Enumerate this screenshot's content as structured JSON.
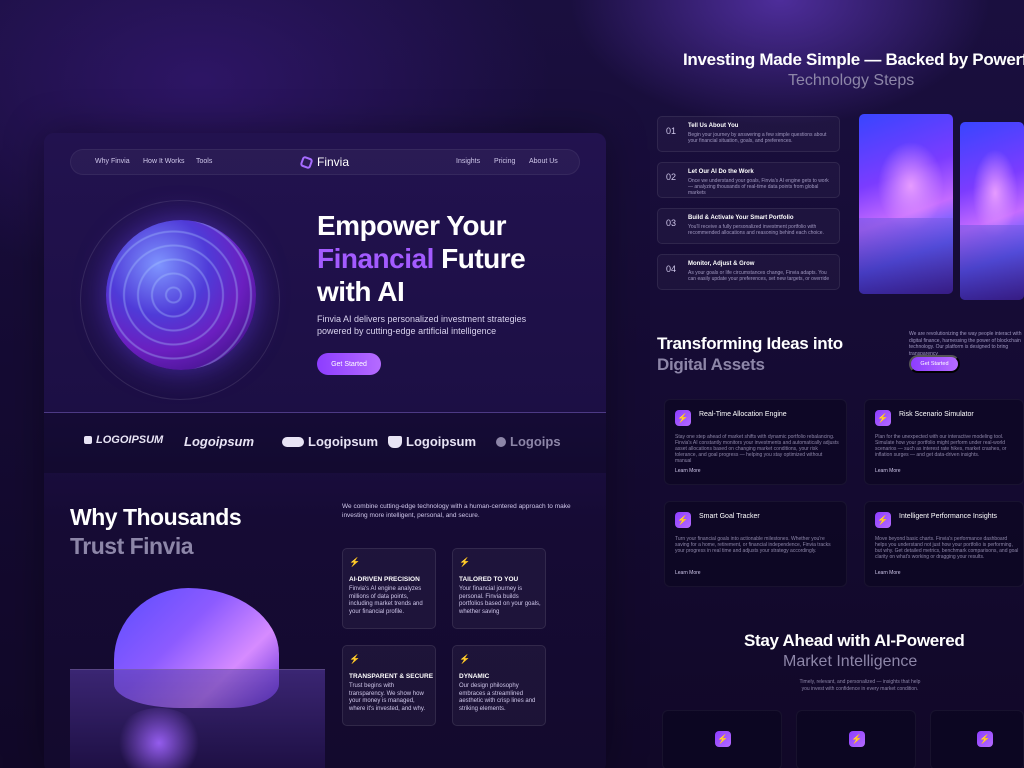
{
  "nav": {
    "left_links": [
      "Why Finvia",
      "How It Works",
      "Tools"
    ],
    "brand": "Finvia",
    "right_links": [
      "Insights",
      "Pricing",
      "About Us"
    ]
  },
  "hero": {
    "title_line1": "Empower Your",
    "title_accent": "Financial",
    "title_line2_rest": " Future",
    "title_line3": "with AI",
    "subtitle": "Finvia AI delivers personalized investment strategies powered by cutting-edge artificial intelligence",
    "cta": "Get Started"
  },
  "logos": [
    "LOGOIPSUM",
    "Logoipsum",
    "Logoipsum",
    "Logoipsum",
    "Logoips"
  ],
  "why": {
    "title_line1": "Why Thousands",
    "title_line2": "Trust Finvia",
    "description": "We combine cutting-edge technology with a human-centered approach to make investing more intelligent, personal, and secure.",
    "features": [
      {
        "title": "AI-DRIVEN PRECISION",
        "text": "Finvia's AI engine analyzes millions of data points, including market trends and your financial profile."
      },
      {
        "title": "TAILORED TO YOU",
        "text": "Your financial journey is personal. Finvia builds portfolios based on your goals, whether saving"
      },
      {
        "title": "TRANSPARENT & SECURE",
        "text": "Trust begins with transparency. We show how your money is managed, where it's invested, and why."
      },
      {
        "title": "DYNAMIC",
        "text": "Our design philosophy embraces a streamlined aesthetic with crisp lines and striking elements."
      }
    ]
  },
  "steps": {
    "title_line1": "Investing Made Simple — Backed by Powerful",
    "title_line2": "Technology Steps",
    "items": [
      {
        "num": "01",
        "title": "Tell Us About You",
        "text": "Begin your journey by answering a few simple questions about your financial situation, goals, and preferences."
      },
      {
        "num": "02",
        "title": "Let Our AI Do the Work",
        "text": "Once we understand your goals, Finvia's AI engine gets to work — analyzing thousands of real-time data points from global markets"
      },
      {
        "num": "03",
        "title": "Build & Activate Your Smart Portfolio",
        "text": "You'll receive a fully personalized investment portfolio with recommended allocations and reasoning behind each choice."
      },
      {
        "num": "04",
        "title": "Monitor, Adjust & Grow",
        "text": "As your goals or life circumstances change, Finvia adapts. You can easily update your preferences, set new targets, or override"
      }
    ]
  },
  "transform": {
    "title_line1": "Transforming Ideas into",
    "title_line2": "Digital Assets",
    "description": "We are revolutionizing the way people interact with digital finance, harnessing the power of blockchain technology. Our platform is designed to bring transparency",
    "cta": "Get Started",
    "services": [
      {
        "title": "Real-Time Allocation Engine",
        "text": "Stay one step ahead of market shifts with dynamic portfolio rebalancing. Finvia's AI constantly monitors your investments and automatically adjusts asset allocations based on changing market conditions, your risk tolerance, and goal progress — helping you stay optimized without manual",
        "link": "Learn More"
      },
      {
        "title": "Risk Scenario Simulator",
        "text": "Plan for the unexpected with our interactive modeling tool. Simulate how your portfolio might perform under real-world scenarios — such as interest rate hikes, market crashes, or inflation surges — and get data-driven insights.",
        "link": "Learn More"
      },
      {
        "title": "Smart Goal Tracker",
        "text": "Turn your financial goals into actionable milestones. Whether you're saving for a home, retirement, or financial independence, Finvia tracks your progress in real time and adjusts your strategy accordingly.",
        "link": "Learn More"
      },
      {
        "title": "Intelligent Performance Insights",
        "text": "Move beyond basic charts. Finvia's performance dashboard helps you understand not just how your portfolio is performing, but why. Get detailed metrics, benchmark comparisons, and goal clarity on what's working or dragging your results.",
        "link": "Learn More"
      }
    ]
  },
  "market": {
    "title_line1": "Stay Ahead with AI-Powered",
    "title_line2": "Market Intelligence",
    "description": "Timely, relevant, and personalized — insights that help you invest with confidence in every market condition."
  },
  "colors": {
    "accent": "#a35bff",
    "background": "#140b2e",
    "button": "#8d3dff"
  },
  "icons": {
    "brand": "finvia-logo-icon",
    "feature": "bolt-icon"
  }
}
